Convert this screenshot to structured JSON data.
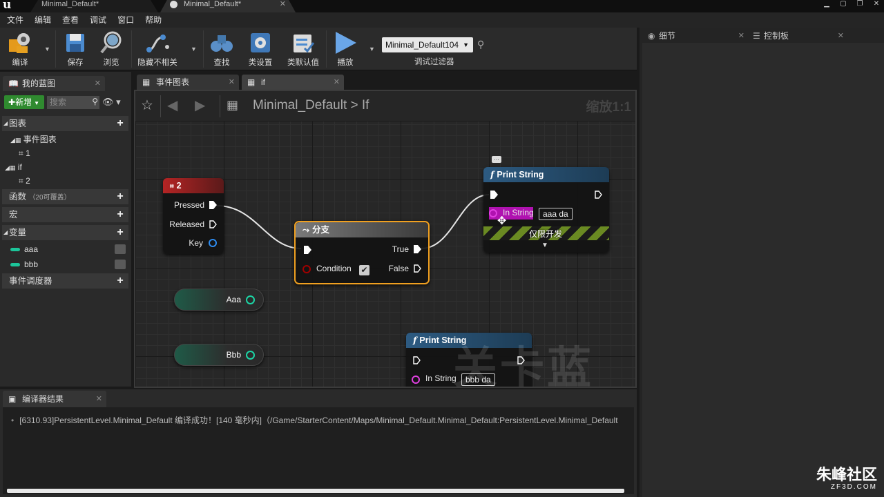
{
  "titlebar": {
    "tabs": [
      {
        "label": "Minimal_Default*"
      },
      {
        "label": "Minimal_Default*"
      }
    ]
  },
  "menu": [
    "文件",
    "编辑",
    "查看",
    "调试",
    "窗口",
    "帮助"
  ],
  "toolbar": {
    "compile": "编译",
    "save": "保存",
    "browse": "浏览",
    "hide_unrelated": "隐藏不相关",
    "find": "查找",
    "class_settings": "类设置",
    "class_defaults": "类默认值",
    "play": "播放",
    "debug_filter_value": "Minimal_Default104",
    "debug_filter_label": "调试过滤器"
  },
  "right_panel": {
    "tabs": [
      {
        "label": "细节"
      },
      {
        "label": "控制板"
      }
    ]
  },
  "left_panel": {
    "tab_label": "我的蓝图",
    "new_button": "新增",
    "search_placeholder": "搜索",
    "sections": {
      "graphs": "图表",
      "functions": "函数",
      "functions_note": "（20可覆盖）",
      "macros": "宏",
      "variables": "变量",
      "dispatchers": "事件调度器"
    },
    "graph_items": [
      {
        "label": "事件图表"
      },
      {
        "label": "1"
      },
      {
        "label": "if"
      },
      {
        "label": "2"
      }
    ],
    "variables": [
      {
        "label": "aaa"
      },
      {
        "label": "bbb"
      }
    ]
  },
  "graph_tabs": [
    {
      "label": "事件图表"
    },
    {
      "label": "if"
    }
  ],
  "graph": {
    "breadcrumb_root": "Minimal_Default",
    "breadcrumb_sep": ">",
    "breadcrumb_leaf": "If",
    "zoom": "缩放1:1",
    "nodes": {
      "key_event": {
        "title": "2",
        "pins": [
          "Pressed",
          "Released",
          "Key"
        ]
      },
      "branch": {
        "title": "分支",
        "true_label": "True",
        "false_label": "False",
        "condition_label": "Condition"
      },
      "print1": {
        "title": "Print String",
        "in_string_label": "In String",
        "in_string_value": "aaa da",
        "dev_only": "仅限开发"
      },
      "print2": {
        "title": "Print String",
        "in_string_label": "In String",
        "in_string_value": "bbb da"
      },
      "var_aaa": {
        "label": "Aaa"
      },
      "var_bbb": {
        "label": "Bbb"
      }
    },
    "watermark": "关卡蓝图"
  },
  "compiler": {
    "tab_label": "编译器结果",
    "log": "[6310.93]PersistentLevel.Minimal_Default 编译成功！[140 毫秒内]（/Game/StarterContent/Maps/Minimal_Default.Minimal_Default:PersistentLevel.Minimal_Default"
  },
  "brand": {
    "name": "朱峰社区",
    "url": "ZF3D.COM"
  },
  "colors": {
    "accent_green": "#2f8a2f",
    "var_teal": "#1cd6a6",
    "event_red": "#b52424",
    "function_blue": "#2d5b82",
    "string_magenta": "#d21cd2",
    "branch_orange": "#f0a020"
  }
}
